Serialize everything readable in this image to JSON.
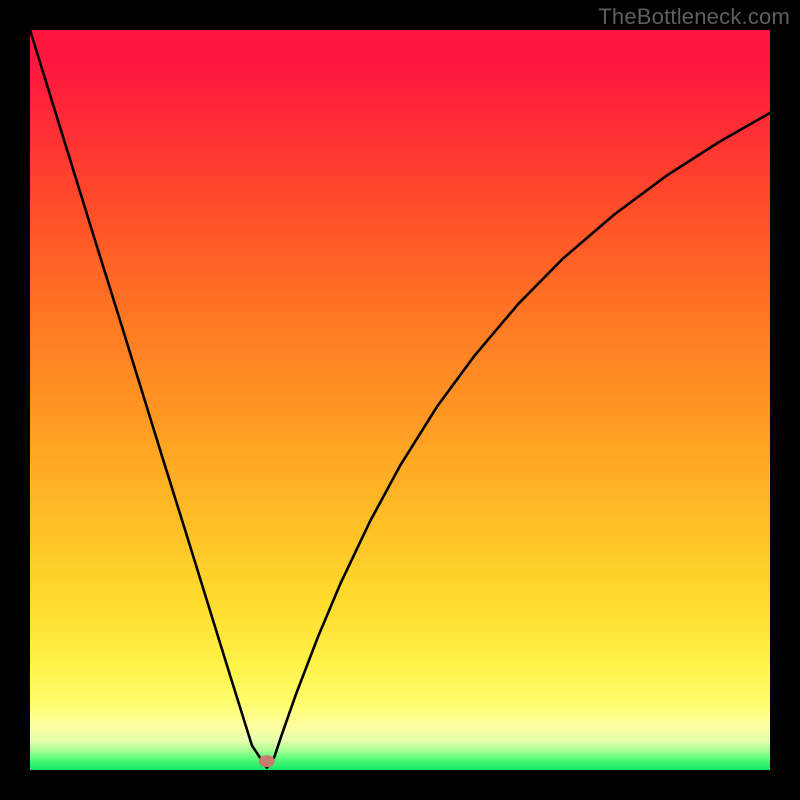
{
  "watermark": {
    "text": "TheBottleneck.com"
  },
  "colors": {
    "background": "#000000",
    "curve": "#000000",
    "marker": "#c97b6e",
    "gradient_top": "#ff153e",
    "gradient_bottom": "#11e768"
  },
  "chart_data": {
    "type": "line",
    "title": "",
    "subtitle": "",
    "xlabel": "",
    "ylabel": "",
    "xlim": [
      0,
      100
    ],
    "ylim": [
      0,
      100
    ],
    "legend_position": "none",
    "grid": false,
    "annotations": [],
    "marker": {
      "x": 32,
      "y": 1.2,
      "color": "#c97b6e"
    },
    "series": [
      {
        "name": "curve",
        "color": "#000000",
        "x": [
          0,
          3,
          6,
          9,
          12,
          15,
          18,
          21,
          24,
          27,
          30,
          31,
          32,
          33,
          34,
          36,
          39,
          42,
          46,
          50,
          55,
          60,
          66,
          72,
          79,
          86,
          93,
          100
        ],
        "y": [
          100,
          90.3,
          80.6,
          70.9,
          61.3,
          51.6,
          41.9,
          32.3,
          22.6,
          12.9,
          3.3,
          1.8,
          0.3,
          1.7,
          4.7,
          10.4,
          18.2,
          25.3,
          33.7,
          41.1,
          49.1,
          55.9,
          63.0,
          69.1,
          75.1,
          80.3,
          84.8,
          88.8
        ]
      }
    ]
  }
}
